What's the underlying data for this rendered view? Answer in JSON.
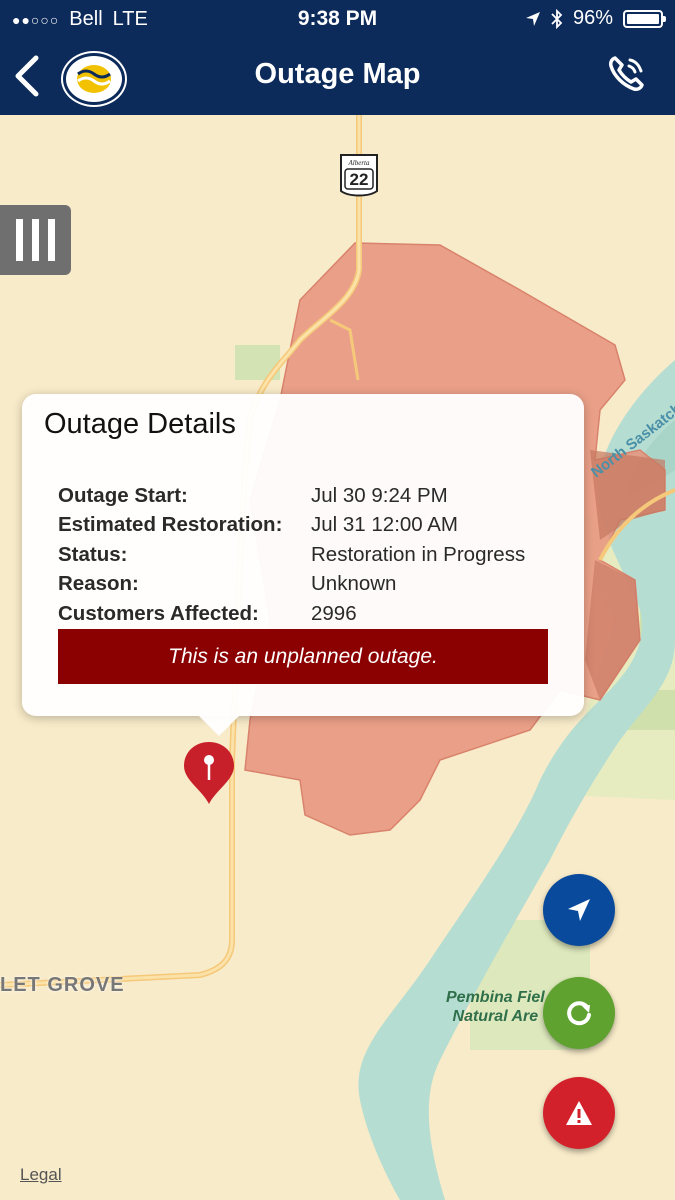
{
  "status_bar": {
    "carrier": "Bell",
    "network": "LTE",
    "time": "9:38 PM",
    "battery": "96%",
    "battery_level": 0.96
  },
  "header": {
    "title": "Outage Map",
    "back_icon": "chevron-left-icon",
    "phone_icon": "phone-icon"
  },
  "map": {
    "highway_number": "22",
    "highway_shield_text": "Alberta",
    "town_label": "LET GROVE",
    "river_label": "North Saskatch",
    "park_label_line1": "Pembina Fiel",
    "park_label_line2": "Natural Are",
    "legal_link": "Legal"
  },
  "popup": {
    "title": "Outage Details",
    "rows": [
      {
        "label": "Outage Start:",
        "value": "Jul 30 9:24 PM"
      },
      {
        "label": "Estimated Restoration:",
        "value": "Jul 31 12:00 AM"
      },
      {
        "label": "Status:",
        "value": "Restoration in Progress"
      },
      {
        "label": "Reason:",
        "value": "Unknown"
      },
      {
        "label": "Customers Affected:",
        "value": "2996"
      }
    ],
    "banner": "This is an unplanned outage."
  },
  "colors": {
    "navbar": "#0c2a5a",
    "outage_area": "#e8937c",
    "banner": "#8b0000",
    "locate_button": "#0a4a9c",
    "refresh_button": "#5fa22f",
    "report_button": "#d3212c"
  }
}
